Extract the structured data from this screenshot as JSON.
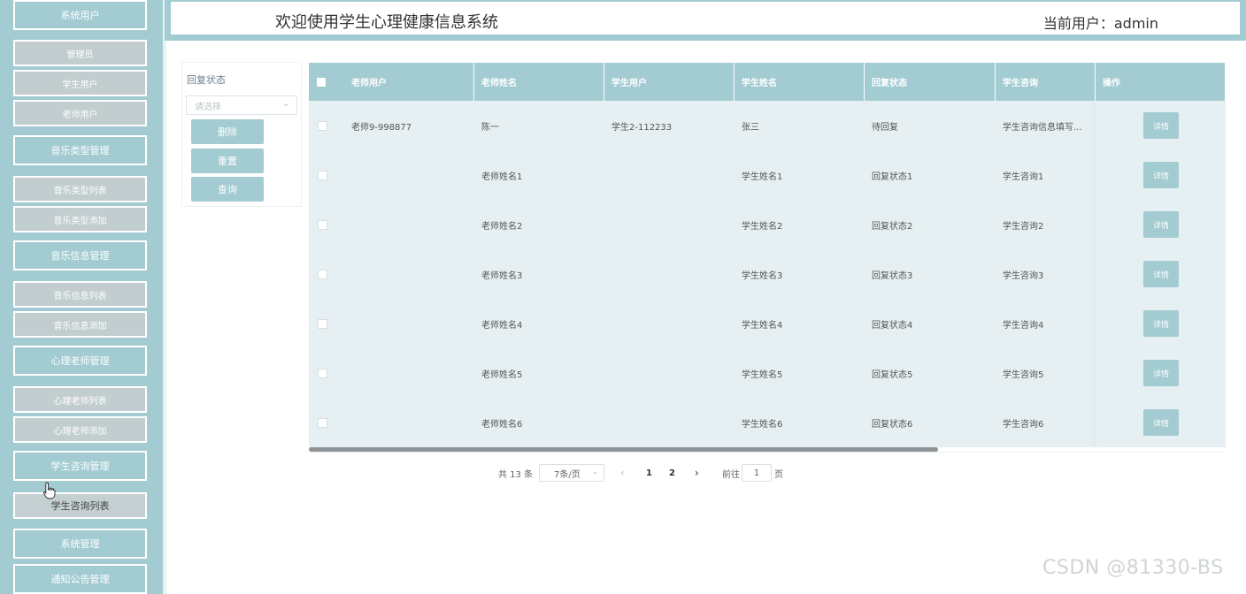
{
  "header": {
    "title": "欢迎使用学生心理健康信息系统",
    "current_user": "当前用户：admin"
  },
  "sidebar": {
    "items": [
      {
        "label": "系统用户",
        "type": "group"
      },
      {
        "label": "管理员",
        "type": "sub"
      },
      {
        "label": "学生用户",
        "type": "sub"
      },
      {
        "label": "老师用户",
        "type": "sub"
      },
      {
        "label": "音乐类型管理",
        "type": "group"
      },
      {
        "label": "音乐类型列表",
        "type": "sub"
      },
      {
        "label": "音乐类型添加",
        "type": "sub"
      },
      {
        "label": "音乐信息管理",
        "type": "group"
      },
      {
        "label": "音乐信息列表",
        "type": "sub"
      },
      {
        "label": "音乐信息添加",
        "type": "sub"
      },
      {
        "label": "心理老师管理",
        "type": "group"
      },
      {
        "label": "心理老师列表",
        "type": "sub"
      },
      {
        "label": "心理老师添加",
        "type": "sub"
      },
      {
        "label": "学生咨询管理",
        "type": "group"
      },
      {
        "label": "学生咨询列表",
        "type": "sub",
        "active": true
      },
      {
        "label": "系统管理",
        "type": "group"
      },
      {
        "label": "通知公告管理",
        "type": "group"
      }
    ]
  },
  "filter": {
    "label": "回复状态",
    "select_placeholder": "请选择",
    "buttons": {
      "delete": "删除",
      "reset": "重置",
      "query": "查询"
    }
  },
  "table": {
    "columns": [
      "老师用户",
      "老师姓名",
      "学生用户",
      "学生姓名",
      "回复状态",
      "学生咨询",
      "操作"
    ],
    "rows": [
      [
        "老师9-998877",
        "陈一",
        "学生2-112233",
        "张三",
        "待回复",
        "学生咨询信息填写..."
      ],
      [
        "",
        "老师姓名1",
        "",
        "学生姓名1",
        "回复状态1",
        "学生咨询1"
      ],
      [
        "",
        "老师姓名2",
        "",
        "学生姓名2",
        "回复状态2",
        "学生咨询2"
      ],
      [
        "",
        "老师姓名3",
        "",
        "学生姓名3",
        "回复状态3",
        "学生咨询3"
      ],
      [
        "",
        "老师姓名4",
        "",
        "学生姓名4",
        "回复状态4",
        "学生咨询4"
      ],
      [
        "",
        "老师姓名5",
        "",
        "学生姓名5",
        "回复状态5",
        "学生咨询5"
      ],
      [
        "",
        "老师姓名6",
        "",
        "学生姓名6",
        "回复状态6",
        "学生咨询6"
      ]
    ],
    "detail_label": "详情"
  },
  "pagination": {
    "total": "共 13 条",
    "page_size": "7条/页",
    "pages": [
      "1",
      "2"
    ],
    "goto_prefix": "前往",
    "goto_value": "1",
    "goto_suffix": "页"
  },
  "watermark": "CSDN @81330-BS",
  "colors": {
    "accent": "#a2cbd2",
    "row_bg": "#e6f0f2",
    "sub_item": "#c2cdcf"
  }
}
